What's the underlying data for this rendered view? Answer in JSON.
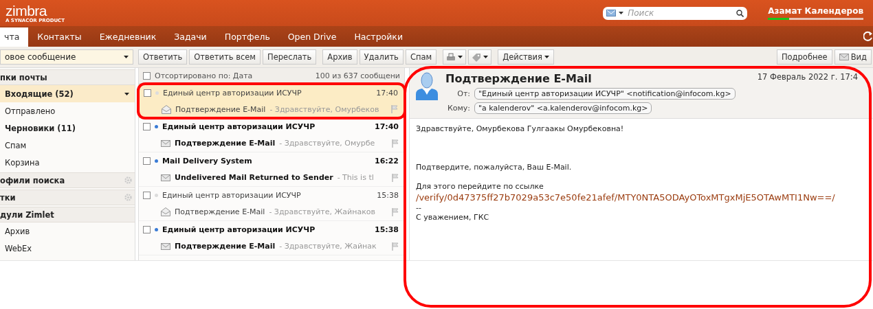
{
  "header": {
    "logo": "zimbra",
    "logo_tagline": "A SYNACOR PRODUCT",
    "search": {
      "placeholder": "Поиск"
    },
    "user": "Азамат Календеров",
    "quota": {
      "level": 0.22
    }
  },
  "tabs": [
    {
      "label": "чта",
      "selected": true
    },
    {
      "label": "Контакты",
      "selected": false
    },
    {
      "label": "Ежедневник",
      "selected": false
    },
    {
      "label": "Задачи",
      "selected": false
    },
    {
      "label": "Портфель",
      "selected": false
    },
    {
      "label": "Open Drive",
      "selected": false
    },
    {
      "label": "Настройки",
      "selected": false
    }
  ],
  "toolbar": {
    "compose": "овое сообщение",
    "items": [
      {
        "kind": "text",
        "label": "Ответить"
      },
      {
        "kind": "text",
        "label": "Ответить всем"
      },
      {
        "kind": "text",
        "label": "Переслать"
      },
      {
        "kind": "text",
        "label": "Архив"
      },
      {
        "kind": "text",
        "label": "Удалить"
      },
      {
        "kind": "text",
        "label": "Спам"
      },
      {
        "kind": "print-menu"
      },
      {
        "kind": "tag-menu"
      },
      {
        "kind": "menu",
        "label": "Действия"
      }
    ],
    "right": [
      {
        "kind": "text",
        "label": "Подробнее"
      },
      {
        "kind": "mail",
        "label": "Вид"
      }
    ]
  },
  "sidebar": {
    "sections": [
      {
        "title": "пки почты",
        "gear": false,
        "items": [
          {
            "label": "Входящие (52)",
            "unread": true,
            "selected": true
          },
          {
            "label": "Отправлено",
            "unread": false,
            "selected": false
          },
          {
            "label": "Черновики (11)",
            "unread": true,
            "selected": false
          },
          {
            "label": "Спам",
            "unread": false,
            "selected": false
          },
          {
            "label": "Корзина",
            "unread": false,
            "selected": false
          }
        ]
      },
      {
        "title": "офили поиска",
        "gear": true
      },
      {
        "title": "тки",
        "gear": true
      },
      {
        "title": "дули Zimlet",
        "gear": false,
        "items": [
          {
            "label": "Архив",
            "unread": false,
            "selected": false
          },
          {
            "label": "WebEx",
            "unread": false,
            "selected": false
          }
        ]
      }
    ]
  },
  "list": {
    "all_checked": false,
    "sort": "Отсортировано по: Дата",
    "count": "100 из 637 сообщени",
    "messages": [
      {
        "sender": "Единый центр авторизации ИСУЧР",
        "time": "17:40",
        "subject": "Подтверждение E-Mail",
        "fragment": "- Здравствуйте, Омурбеков",
        "unread": false,
        "selected": true,
        "checked": false,
        "annotated": true
      },
      {
        "sender": "Единый центр авторизации ИСУЧР",
        "time": "17:40",
        "subject": "Подтверждение E-Mail",
        "fragment": "- Здравствуйте, Омурбе",
        "unread": true,
        "selected": false,
        "checked": false,
        "annotated": false
      },
      {
        "sender": "Mail Delivery System",
        "time": "16:22",
        "subject": "Undelivered Mail Returned to Sender",
        "fragment": "- This is tl",
        "unread": true,
        "selected": false,
        "checked": false,
        "annotated": false
      },
      {
        "sender": "Единый центр авторизации ИСУЧР",
        "time": "15:38",
        "subject": "Подтверждение E-Mail",
        "fragment": "- Здравствуйте, Жайнаков",
        "unread": false,
        "selected": false,
        "checked": false,
        "annotated": false
      },
      {
        "sender": "Единый центр авторизации ИСУЧР",
        "time": "15:38",
        "subject": "Подтверждение E-Mail",
        "fragment": "- Здравствуйте, Жайнак",
        "unread": true,
        "selected": false,
        "checked": false,
        "annotated": false
      }
    ]
  },
  "reading_pane": {
    "annotated": true,
    "subject": "Подтверждение E-Mail",
    "date": "17 Февраль 2022 г. 17:4",
    "from_label": "От:",
    "from": "\"Единый центр авторизации ИСУЧР\" <notification@infocom.kg>",
    "to_label": "Кому:",
    "to": "\"a kalenderov\" <a.kalenderov@infocom.kg>",
    "body": [
      {
        "kind": "text",
        "text": "Здравствуйте, Омурбекова Гулгаакы Омурбековна!"
      },
      {
        "kind": "break"
      },
      {
        "kind": "break"
      },
      {
        "kind": "break"
      },
      {
        "kind": "text",
        "text": "Подтвердите, пожалуйста, Ваш E-Mail."
      },
      {
        "kind": "break"
      },
      {
        "kind": "text",
        "text": "Для этого перейдите по ссылке"
      },
      {
        "kind": "link",
        "text": "/verify/0d47375ff27b7029a53c7e50fe21afef/MTY0NTA5ODAyOToxMTgxMjE5OTAwMTI1Nw==/"
      },
      {
        "kind": "text",
        "text": "--"
      },
      {
        "kind": "text",
        "text": "С уважением, ГКС"
      }
    ]
  }
}
